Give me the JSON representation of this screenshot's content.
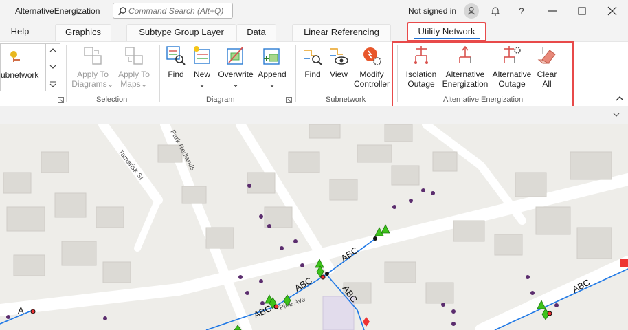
{
  "app": {
    "title": "AlternativeEnergization",
    "search_placeholder": "Command Search (Alt+Q)",
    "signin_text": "Not signed in",
    "help_symbol": "?"
  },
  "tabs": [
    {
      "label": "Help",
      "active": false
    },
    {
      "label": "Graphics",
      "active": false
    },
    {
      "label": "Subtype Group Layer",
      "active": false
    },
    {
      "label": "Data",
      "active": false
    },
    {
      "label": "Linear Referencing",
      "active": false
    },
    {
      "label": "Utility Network",
      "active": true
    }
  ],
  "ribbon": {
    "gallery_label": "ubnetwork",
    "selection": {
      "group_label": "Selection",
      "apply_diagrams": [
        "Apply To",
        "Diagrams"
      ],
      "apply_maps": [
        "Apply To",
        "Maps"
      ]
    },
    "diagram": {
      "group_label": "Diagram",
      "find": "Find",
      "new": "New",
      "overwrite": "Overwrite",
      "append": "Append"
    },
    "subnetwork": {
      "group_label": "Subnetwork",
      "find": "Find",
      "view": "View",
      "modify": [
        "Modify",
        "Controller"
      ]
    },
    "alt_energization": {
      "group_label": "Alternative Energization",
      "isolation": [
        "Isolation",
        "Outage"
      ],
      "alt_energ": [
        "Alternative",
        "Energization"
      ],
      "alt_outage": [
        "Alternative",
        "Outage"
      ],
      "clear_all": [
        "Clear",
        "All"
      ]
    }
  },
  "map": {
    "streets": [
      "Tamarisk St",
      "Park Redlands",
      "Pine Ave"
    ],
    "line_labels": [
      "ABC",
      "ABC",
      "ABC",
      "ABC",
      "ABC",
      "A"
    ]
  },
  "colors": {
    "accent": "#1e6fcf",
    "highlight": "#e84a4a",
    "line": "#1e78e6",
    "device": "#3ec21b",
    "point": "#5b2d6e"
  }
}
